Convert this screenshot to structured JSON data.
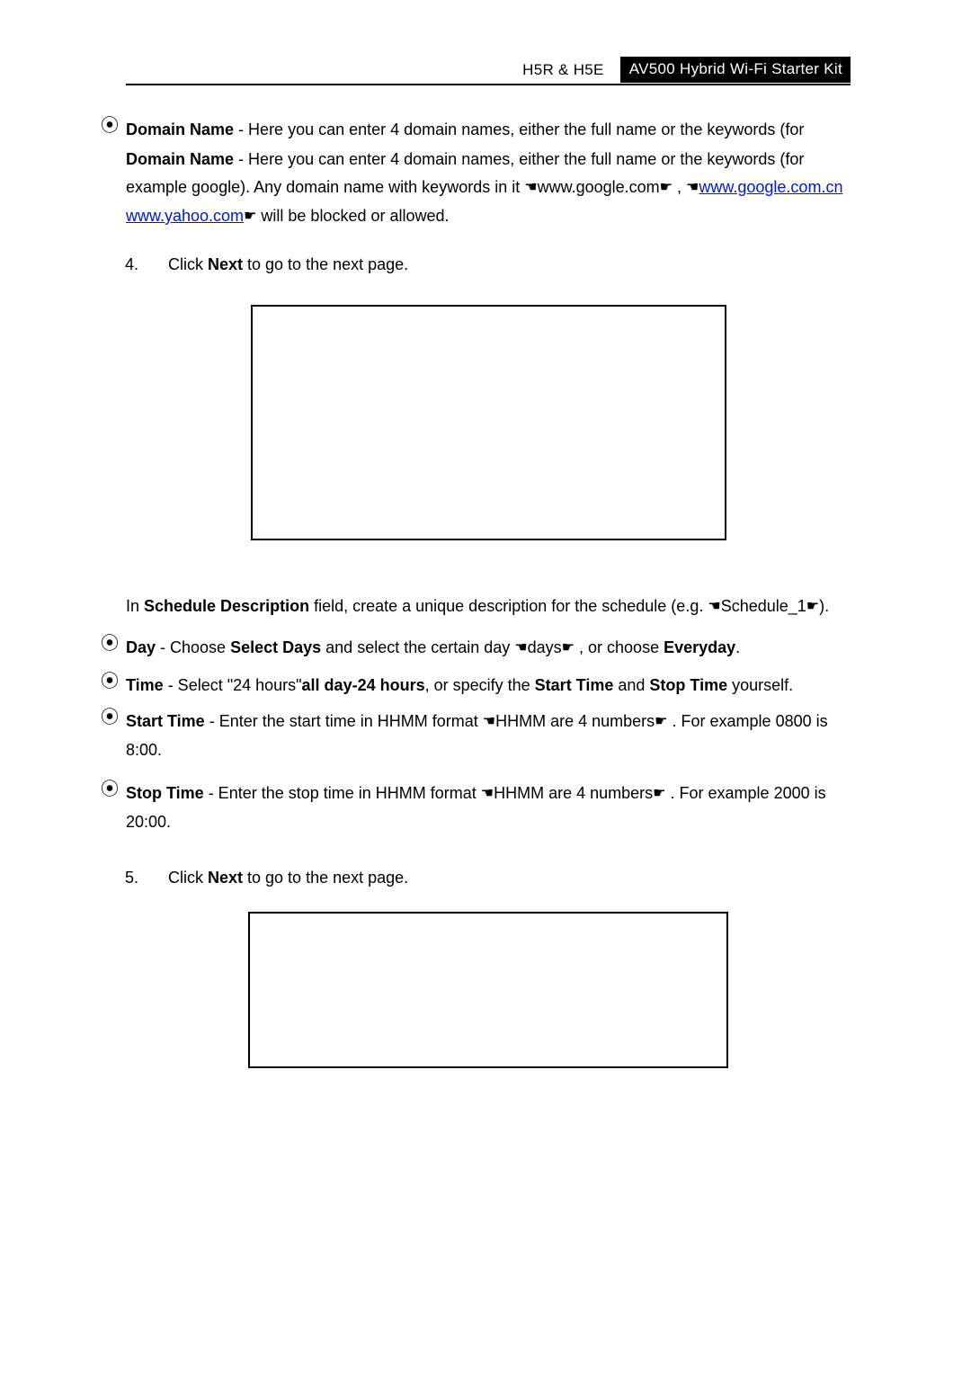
{
  "header": {
    "model": "H5R & H5E",
    "product": "AV500 Hybrid Wi-Fi Starter Kit"
  },
  "body": {
    "domain_label": "Domain Name",
    "domain_text_1": " -  Here  you  can  enter  4  domain  names,  either  the  full  name  or  the  keywords  (for",
    "domain_text_2a": " -  Here  you  can  enter  4  domain  names,  either  the  full  name  or  the  keywords  (for example google). Any domain name with keywords in it ",
    "domain_text_2b": "www.google.com",
    "domain_text_2c": ", ",
    "link1": "www.google.com.cn",
    "link2": "www.yahoo.com",
    "domain_text_2d": " will be blocked or allowed.",
    "step4": {
      "num": "4.",
      "a": "Click ",
      "next": "Next",
      "b": " to go to the next page."
    },
    "sched_intro_a": "In ",
    "sched_desc_label": "Schedule Description",
    "sched_intro_b": " field, create a unique description for the schedule (e.g.",
    "sched_intro_c": "Schedule_1",
    "sched_intro_d": ").",
    "day": {
      "label": "Day",
      "a": " - Choose ",
      "select": "Select Days",
      "b": " and select the certain day ",
      "c": "days",
      "d": ", or choose ",
      "every": "Everyday",
      "e": "."
    },
    "time": {
      "label": "Time",
      "a": " - Select \"24 hours\"",
      "allday": "all day-24 hours",
      "b": ", or specify the ",
      "start": "Start Time",
      "c": " and ",
      "stop": "Stop Time",
      "d": " yourself."
    },
    "start": {
      "label": "Start Time",
      "a": " - Enter the start time in HHMM format ",
      "b": "HHMM are 4 numbers",
      "c": ". For example 0800 is 8:00."
    },
    "stop": {
      "label": "Stop Time",
      "a": " - Enter the stop time in HHMM format ",
      "b": "HHMM are 4 numbers",
      "c": ". For example 2000 is 20:00."
    },
    "step5": {
      "num": "5.",
      "a": "Click ",
      "next": "Next",
      "b": " to go to the next page."
    }
  }
}
